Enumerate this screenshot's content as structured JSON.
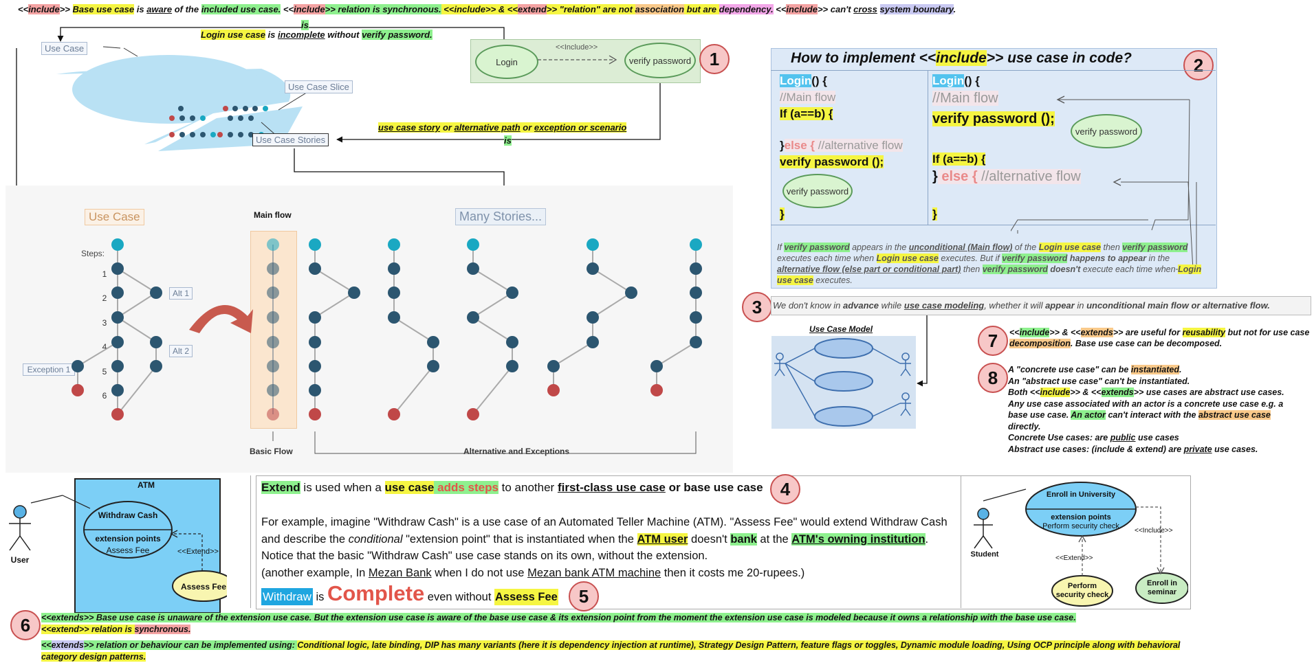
{
  "top_line": {
    "p1": "<<",
    "include1": "include",
    "p2": ">> ",
    "base_use_case": "Base use case",
    "p3": " is ",
    "aware": "aware",
    "p4": " of the ",
    "included_use_case": "included use case.",
    "p5": " <<",
    "include2": "include",
    "p6": ">> relation is synchronous.",
    "p7": " <<",
    "include3": "include",
    "p8": ">> & <<",
    "extend": "extend",
    "p9": ">> \"relation\" are not ",
    "association": "association",
    "p10": " but are ",
    "dependency": "dependency.",
    "p11": " <<",
    "include4": "include",
    "p12": ">>  can't ",
    "cross": "cross",
    "p13": " ",
    "system_boundary": "system boundary",
    "p14": "."
  },
  "is_label_top": "is",
  "login_incomplete": {
    "a": "Login use case",
    "b": " is ",
    "c": "incomplete",
    "d": " without ",
    "e": "verify password."
  },
  "slice_diagram": {
    "use_case": "Use Case",
    "use_case_slice": "Use Case Slice",
    "use_case_stories": "Use Case Stories"
  },
  "story_label": {
    "a": "use case story",
    "b": " or ",
    "c": "alternative path",
    "d": " or ",
    "e": "exception or scenario",
    "is": "is"
  },
  "include_diagram": {
    "login": "Login",
    "include": "<<Include>>",
    "verify": "verify password",
    "number": "1"
  },
  "code_panel": {
    "title_a": "How to implement <<",
    "title_b": "include",
    "title_c": ">> use case in code?",
    "number": "2",
    "left": {
      "login": "Login",
      "login_rest": "() {",
      "main_flow": "//Main flow",
      "if": "If (a==b) {",
      "close_else": "}",
      "else_kw": "else {",
      "alt_flow": " //alternative flow",
      "verify_call": "verify password ();",
      "ellipse": "verify password",
      "close": "}"
    },
    "right": {
      "login": "Login",
      "login_rest": "() {",
      "main_flow": "//Main flow",
      "verify_call": "verify password ();",
      "ellipse": "verify password",
      "if": "If  (a==b)  {",
      "close_else": "}",
      "else_kw": " else {",
      "alt_flow": " //alternative flow",
      "close": "}"
    },
    "explain": {
      "s1": "If ",
      "s2": "verify password",
      "s3": " appears in the ",
      "s4": "unconditional (Main flow)",
      "s5": " of the ",
      "s6": "Login use case",
      "s7": " then ",
      "s8": "verify password",
      "s9": " executes each time when ",
      "s10": "Login use case",
      "s11": " executes. But if ",
      "s12": "verify password",
      "s13": " happens to appear",
      "s14": " in the ",
      "s15": "alternative flow (else part or conditional part)",
      "s16": " then ",
      "s17": "verify password",
      "s18": " doesn't",
      "s19": " execute each time when ",
      "s20": "Login use case",
      "s21": " executes."
    }
  },
  "note3": {
    "number": "3",
    "a": "We don't know in ",
    "b": "advance",
    "c": " while ",
    "d": "use case modeling",
    "e": ", whether it will ",
    "f": "appear",
    "g": " in ",
    "h": "unconditional main flow or alternative flow."
  },
  "use_case_model_label": "Use Case Model",
  "note7": {
    "number": "7",
    "a": "<<",
    "b": "include",
    "c": ">>  & <<",
    "d": "extends",
    "e": ">> are useful for ",
    "f": "reusability",
    "g": " but not for use case ",
    "h": "decomposition",
    "i": ". Base use case can be decomposed."
  },
  "note8": {
    "number": "8",
    "l1a": "A \"concrete use case\" can be ",
    "l1b": "instantiated",
    "l1c": ".",
    "l2": "An \"abstract use case\" can't be instantiated.",
    "l3a": "Both <<",
    "l3b": "include",
    "l3c": ">> & <<",
    "l3d": "extends",
    "l3e": ">> use cases are abstract use cases. Any use case associated with an actor is a concrete use case e.g. a base use case. ",
    "l3f": "An actor",
    "l3g": " can't interact with the ",
    "l3h": "abstract use case",
    "l3i": " directly.",
    "l4a": "Concrete Use cases: are ",
    "l4b": "public",
    "l4c": " use cases",
    "l5a": "Abstract use cases: (include & extend) are ",
    "l5b": "private",
    "l5c": " use cases."
  },
  "flows": {
    "use_case": "Use Case",
    "main_flow": "Main flow",
    "many_stories": "Many Stories...",
    "steps": "Steps:",
    "step_numbers": [
      "1",
      "2",
      "3",
      "4",
      "5",
      "6"
    ],
    "alt1": "Alt 1",
    "alt2": "Alt 2",
    "exception": "Exception 1",
    "basic_flow": "Basic Flow",
    "alt_exceptions": "Alternative and Exceptions"
  },
  "atm_left": {
    "title": "ATM",
    "withdraw": "Withdraw Cash",
    "ext_points": "extension points",
    "assess": "Assess Fee",
    "extend": "<<Extend>>",
    "assess_fee": "Assess Fee",
    "user": "User"
  },
  "extend_text": {
    "number4": "4",
    "h1": "Extend",
    "h2": " is used when a ",
    "h3": "use case",
    "h4": " adds steps",
    "h5": " to another ",
    "h6": "first-class use case",
    "h7": " or base use case",
    "p1": "For example, imagine \"Withdraw Cash\" is a use case of an Automated Teller Machine (ATM). \"Assess Fee\" would extend Withdraw Cash and describe the ",
    "p1i": "conditional",
    "p2": " \"extension point\" that is instantiated when the ",
    "p3": "ATM user",
    "p4": " doesn't ",
    "p5": "bank",
    "p6": " at the ",
    "p7": "ATM's owning institution",
    "p8": ". Notice that the basic \"Withdraw Cash\" use case stands on its own, without the extension.",
    "p9": "(another example, In ",
    "p10": "Mezan Bank",
    "p11": " when I do not use ",
    "p12": "Mezan bank ATM machine",
    "p13": " then it costs me 20-rupees.)",
    "w1": "Withdraw",
    "w2": " is ",
    "w3": "Complete",
    "w4": " even without ",
    "w5": "Assess Fee",
    "number5": "5"
  },
  "university": {
    "enroll": "Enroll in University",
    "ext_points": "extension points",
    "perf_check": "Perform security check",
    "include": "<<Include>>",
    "extend": "<<Extend>>",
    "perform": "Perform security check",
    "seminar": "Enroll in seminar",
    "student": "Student"
  },
  "note6": {
    "number": "6",
    "l1": "<<extends>> Base use case is unaware of the extension use case. But the extension use case is aware of the base use case & its extension point from the moment the extension use case is modeled because it owns a relationship with the base use case.",
    "l2a": "<<",
    "l2b": "extend",
    "l2c": ">> relation is ",
    "l2d": "synchronous.",
    "l3a": "<<",
    "l3b": "extends",
    "l3c": ">> relation or behaviour can be  implemented using: ",
    "l3d": "Conditional logic, late binding, DIP has many variants (here it is dependency injection at runtime), Strategy Design Pattern, feature flags or toggles, Dynamic module loading, Using OCP principle along with behavioral category design patterns."
  },
  "colors": {
    "green_highlight": "#8ef08e",
    "yellow_highlight": "#f5f542",
    "red_highlight": "#f4a3a3",
    "orange_highlight": "#f9c98a",
    "node_dark": "#2c5670",
    "node_teal": "#1aa8c2",
    "node_red": "#c04848",
    "atm_blue": "#7ccff6"
  }
}
